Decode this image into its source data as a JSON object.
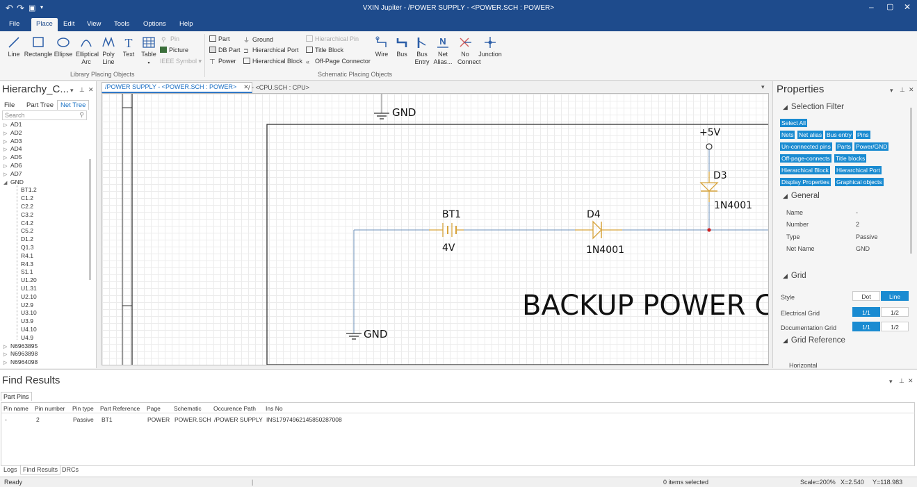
{
  "window": {
    "title": "VXIN Jupiter - /POWER SUPPLY - <POWER.SCH : POWER>"
  },
  "menu": [
    "File",
    "Place",
    "Edit",
    "View",
    "Tools",
    "Options",
    "Help"
  ],
  "ribbon": {
    "line": "Line",
    "rectangle": "Rectangle",
    "ellipse": "Ellipse",
    "elliptical_arc": "Elliptical Arc",
    "poly_line": "Poly Line",
    "text": "Text",
    "table": "Table",
    "pin": "Pin",
    "picture": "Picture",
    "ieee_symbol": "IEEE Symbol",
    "group1": "Library Placing Objects",
    "part": "Part",
    "db_part": "DB Part",
    "power": "Power",
    "ground": "Ground",
    "hierarchical_port": "Hierarchical Port",
    "hierarchical_block": "Hierarchical Block",
    "hierarchical_pin": "Hierarchical Pin",
    "title_block": "Title Block",
    "off_page_connector": "Off-Page Connector",
    "wire": "Wire",
    "bus": "Bus",
    "bus_entry": "Bus Entry",
    "net_alias": "Net Alias...",
    "no_connect": "No Connect",
    "junction": "Junction",
    "group2": "Schematic Placing Objects"
  },
  "left": {
    "title": "Hierarchy_C...",
    "tabs": [
      "File",
      "Part Tree",
      "Net Tree"
    ],
    "search_placeholder": "Search",
    "tree": [
      {
        "label": "AD1",
        "level": 0,
        "arrow": "▷"
      },
      {
        "label": "AD2",
        "level": 0,
        "arrow": "▷"
      },
      {
        "label": "AD3",
        "level": 0,
        "arrow": "▷"
      },
      {
        "label": "AD4",
        "level": 0,
        "arrow": "▷"
      },
      {
        "label": "AD5",
        "level": 0,
        "arrow": "▷"
      },
      {
        "label": "AD6",
        "level": 0,
        "arrow": "▷"
      },
      {
        "label": "AD7",
        "level": 0,
        "arrow": "▷"
      },
      {
        "label": "GND",
        "level": 0,
        "arrow": "◢"
      },
      {
        "label": "BT1.2",
        "level": 1,
        "arrow": ""
      },
      {
        "label": "C1.2",
        "level": 1,
        "arrow": ""
      },
      {
        "label": "C2.2",
        "level": 1,
        "arrow": ""
      },
      {
        "label": "C3.2",
        "level": 1,
        "arrow": ""
      },
      {
        "label": "C4.2",
        "level": 1,
        "arrow": ""
      },
      {
        "label": "C5.2",
        "level": 1,
        "arrow": ""
      },
      {
        "label": "D1.2",
        "level": 1,
        "arrow": ""
      },
      {
        "label": "Q1.3",
        "level": 1,
        "arrow": ""
      },
      {
        "label": "R4.1",
        "level": 1,
        "arrow": ""
      },
      {
        "label": "R4.3",
        "level": 1,
        "arrow": ""
      },
      {
        "label": "S1.1",
        "level": 1,
        "arrow": ""
      },
      {
        "label": "U1.20",
        "level": 1,
        "arrow": ""
      },
      {
        "label": "U1.31",
        "level": 1,
        "arrow": ""
      },
      {
        "label": "U2.10",
        "level": 1,
        "arrow": ""
      },
      {
        "label": "U2.9",
        "level": 1,
        "arrow": ""
      },
      {
        "label": "U3.10",
        "level": 1,
        "arrow": ""
      },
      {
        "label": "U3.9",
        "level": 1,
        "arrow": ""
      },
      {
        "label": "U4.10",
        "level": 1,
        "arrow": ""
      },
      {
        "label": "U4.9",
        "level": 1,
        "arrow": ""
      },
      {
        "label": "N6963895",
        "level": 0,
        "arrow": "▷"
      },
      {
        "label": "N6963898",
        "level": 0,
        "arrow": "▷"
      },
      {
        "label": "N6964098",
        "level": 0,
        "arrow": "▷"
      }
    ]
  },
  "doc_tabs": {
    "active": "/POWER SUPPLY - <POWER.SCH : POWER>",
    "other": "/ - <CPU.SCH : CPU>"
  },
  "schematic": {
    "gnd_top": "GND",
    "gnd_bottom": "GND",
    "vcc": "+5V",
    "bt1_ref": "BT1",
    "bt1_val": "4V",
    "d4_ref": "D4",
    "d4_val": "1N4001",
    "d3_ref": "D3",
    "d3_val": "1N4001",
    "title": "BACKUP POWER CI",
    "wire_color": "#6b8fb8",
    "part_color": "#d7a33b",
    "junction_color": "#cc2222"
  },
  "properties": {
    "title": "Properties",
    "selection_filter": "Selection Filter",
    "chips": [
      "Select All",
      "Nets",
      "Net alias",
      "Bus entry",
      "Pins",
      "Un-connected pins",
      "Parts",
      "Power/GND",
      "Off-page-connects",
      "Title blocks",
      "Hierarchical Block",
      "Hierarchical Port",
      "Display Properties",
      "Graphical objects"
    ],
    "general": "General",
    "general_rows": [
      {
        "label": "Name",
        "value": "-"
      },
      {
        "label": "Number",
        "value": "2"
      },
      {
        "label": "Type",
        "value": "Passive"
      },
      {
        "label": "Net Name",
        "value": "GND"
      }
    ],
    "grid": "Grid",
    "style_label": "Style",
    "dot": "Dot",
    "line": "Line",
    "electrical_grid": "Electrical Grid",
    "documentation_grid": "Documentation Grid",
    "g11": "1/1",
    "g12": "1/2",
    "grid_reference": "Grid Reference",
    "horizontal": "Horizontal"
  },
  "find": {
    "title": "Find Results",
    "tab": "Part Pins",
    "headers": [
      "Pin name",
      "Pin number",
      "Pin type",
      "Part Reference",
      "Page",
      "Schematic",
      "Occurence Path",
      "Ins No"
    ],
    "row": [
      "-",
      "2",
      "Passive",
      "BT1",
      "POWER",
      "POWER.SCH",
      "/POWER SUPPLY",
      "INS17974962145850287008"
    ]
  },
  "bottom_tabs": [
    "Logs",
    "Find Results",
    "DRCs"
  ],
  "status": {
    "ready": "Ready",
    "selected": "0 items selected",
    "scale": "Scale=200%",
    "x": "X=2.540",
    "y": "Y=118.983"
  },
  "accent": "#1e4b8c",
  "chip_color": "#1a8bd1"
}
